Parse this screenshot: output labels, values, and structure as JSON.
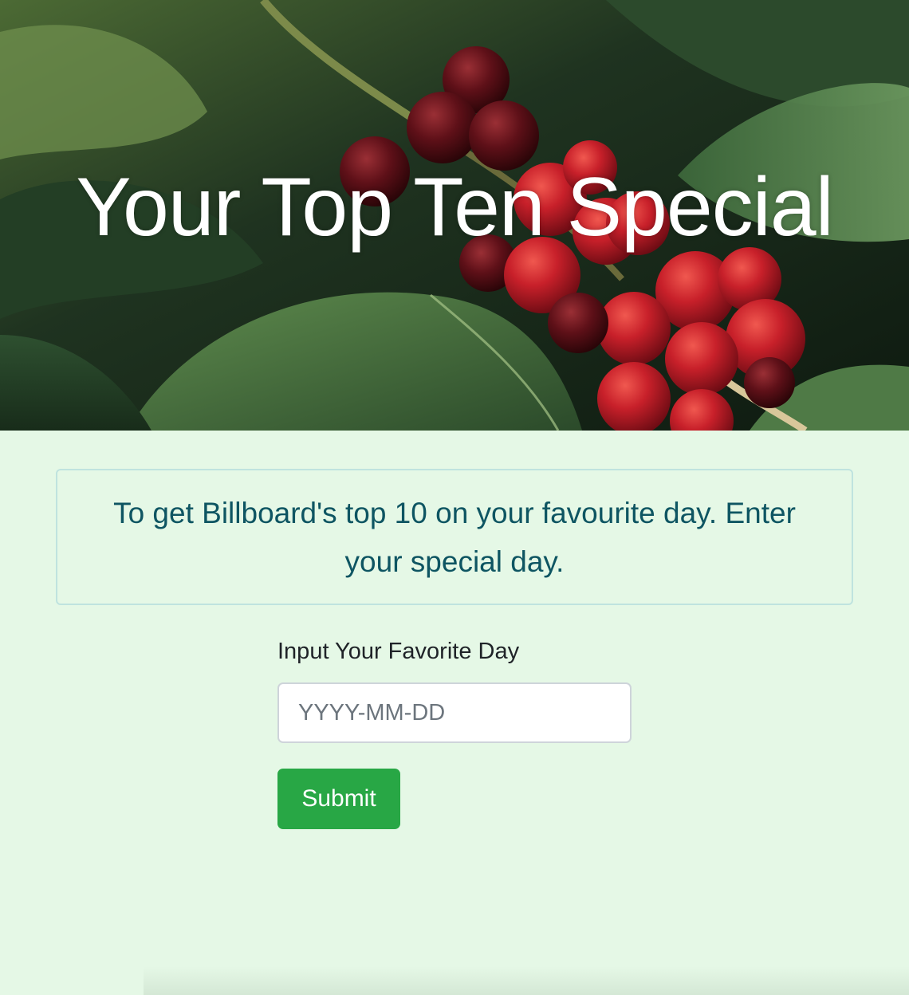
{
  "hero": {
    "title": "Your Top Ten Special",
    "background": "coffee-cherries-photo"
  },
  "info": {
    "text": "To get Billboard's top 10 on your favourite day. Enter your special day."
  },
  "form": {
    "label": "Input Your Favorite Day",
    "date_input": {
      "placeholder": "YYYY-MM-DD",
      "value": ""
    },
    "submit_label": "Submit"
  },
  "colors": {
    "page_background": "#e5f8e6",
    "info_text": "#0e5562",
    "info_border": "#bfe3df",
    "submit_button": "#28a745"
  }
}
